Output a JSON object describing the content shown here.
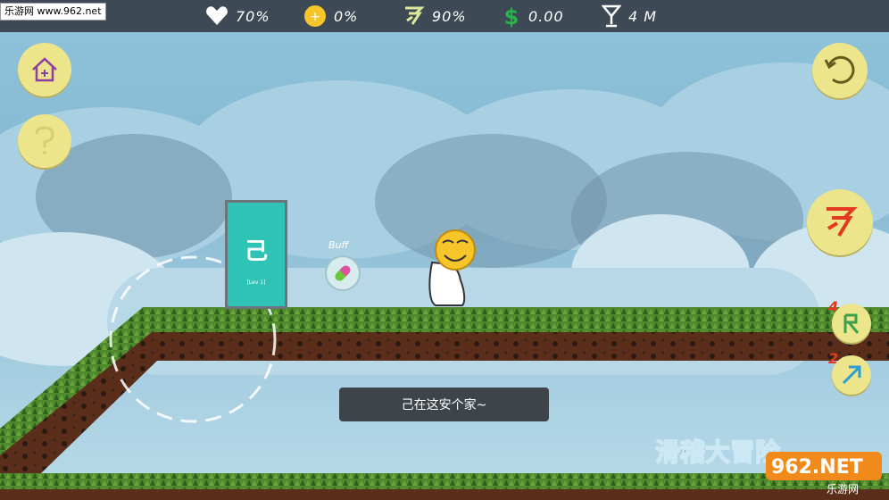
{
  "watermark": {
    "text": "乐游网 www.962.net"
  },
  "hud": {
    "health": {
      "icon": "heart-icon",
      "value": "70%"
    },
    "coin": {
      "icon": "coin-icon",
      "value": "0%"
    },
    "energy": {
      "icon": "runner-icon",
      "value": "90%"
    },
    "money": {
      "icon": "dollar-icon",
      "value": "0.00"
    },
    "distance": {
      "icon": "cocktail-glass-icon",
      "value": "4 M"
    }
  },
  "buttons": {
    "home": {
      "icon": "house-icon"
    },
    "help": {
      "icon": "question-icon"
    },
    "restart": {
      "icon": "refresh-icon"
    },
    "run": {
      "icon": "runner-icon"
    },
    "skill_r": {
      "icon": "r-skill-icon",
      "count": "4"
    },
    "skill_jump": {
      "icon": "arrow-up-right-icon",
      "count": "2"
    }
  },
  "door": {
    "sign": "己",
    "caption": "[Lev 1]"
  },
  "buff": {
    "label": "Buff",
    "icon": "pill-icon"
  },
  "dialog": {
    "text": "己在这安个家~"
  },
  "logo": {
    "title": "滑稽大冒险",
    "brand": "962.NET",
    "brand_sub": "乐游网"
  },
  "colors": {
    "hud_bg": "#3d4a55",
    "button_bg": "#ece58c",
    "grass": "#4f8a2e",
    "dirt": "#5a2e1a",
    "door": "#2ec3b4"
  }
}
